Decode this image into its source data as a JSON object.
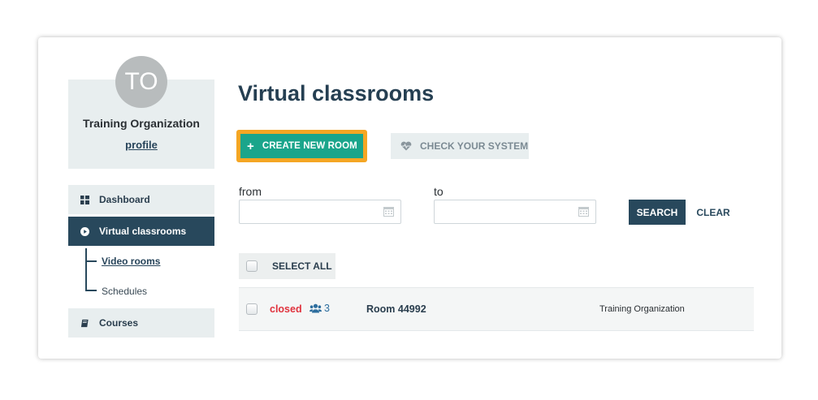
{
  "sidebar": {
    "avatar_initials": "TO",
    "org_name": "Training Organization",
    "profile_link": "profile",
    "nav": [
      {
        "label": "Dashboard",
        "icon": "dashboard-grid-icon",
        "active": false
      },
      {
        "label": "Virtual classrooms",
        "icon": "play-circle-icon",
        "active": true
      },
      {
        "label": "Courses",
        "icon": "book-icon",
        "active": false
      }
    ],
    "sub_items": [
      {
        "label": "Video rooms",
        "current": true
      },
      {
        "label": "Schedules",
        "current": false
      }
    ]
  },
  "main": {
    "title": "Virtual classrooms",
    "create_button": {
      "plus": "+",
      "label": "CREATE NEW ROOM",
      "icon": "plus-icon"
    },
    "check_button": {
      "label": "CHECK YOUR SYSTEM",
      "icon": "heartbeat-icon"
    },
    "filters": {
      "from_label": "from",
      "from_value": "",
      "to_label": "to",
      "to_value": "",
      "search_label": "SEARCH",
      "clear_label": "CLEAR"
    },
    "select_all_label": "SELECT ALL",
    "rooms": [
      {
        "status": "closed",
        "participants": "3",
        "name": "Room 44992",
        "organization": "Training Organization"
      }
    ]
  },
  "colors": {
    "accent_teal": "#1aa58b",
    "highlight_orange": "#f5a623",
    "navy": "#28485c",
    "status_closed": "#e0323d",
    "participants_blue": "#2d6e9e"
  }
}
